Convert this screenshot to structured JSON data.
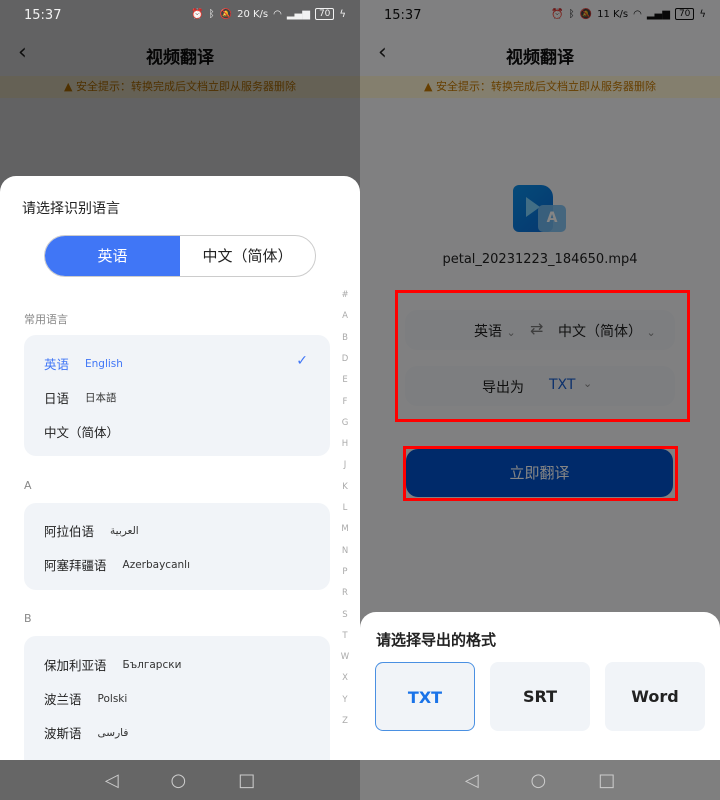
{
  "status_left": {
    "time": "15:37",
    "speed": "20 K/s",
    "battery": "70"
  },
  "status_right": {
    "time": "15:37",
    "speed": "11 K/s",
    "battery": "70"
  },
  "header": {
    "title": "视频翻译",
    "back": "‹"
  },
  "banner": {
    "icon": "warning-icon",
    "text": "安全提示：转换完成后文档立即从服务器删除"
  },
  "language_sheet": {
    "title": "请选择识别语言",
    "tabs": [
      {
        "label": "英语",
        "selected": true
      },
      {
        "label": "中文（简体）",
        "selected": false
      }
    ],
    "sections": [
      {
        "header": "常用语言",
        "items": [
          {
            "label": "英语",
            "native": "English",
            "selected": true
          },
          {
            "label": "日语",
            "native": "日本語"
          },
          {
            "label": "中文（简体）",
            "native": ""
          }
        ]
      },
      {
        "header": "A",
        "items": [
          {
            "label": "阿拉伯语",
            "native": "العربية"
          },
          {
            "label": "阿塞拜疆语",
            "native": "Azerbaycanlı"
          }
        ]
      },
      {
        "header": "B",
        "items": [
          {
            "label": "保加利亚语",
            "native": "Български"
          },
          {
            "label": "波兰语",
            "native": "Polski"
          },
          {
            "label": "波斯语",
            "native": "فارسی"
          }
        ]
      }
    ],
    "index": [
      "#",
      "A",
      "B",
      "D",
      "E",
      "F",
      "G",
      "H",
      "J",
      "K",
      "L",
      "M",
      "N",
      "P",
      "R",
      "S",
      "T",
      "W",
      "X",
      "Y",
      "Z"
    ]
  },
  "translate": {
    "filename": "petal_20231223_184650.mp4",
    "source": "英语",
    "target": "中文（简体）",
    "export_label": "导出为",
    "export_value": "TXT",
    "button": "立即翻译"
  },
  "format_sheet": {
    "title": "请选择导出的格式",
    "options": [
      {
        "label": "TXT",
        "selected": true
      },
      {
        "label": "SRT"
      },
      {
        "label": "Word"
      }
    ]
  },
  "nav": {
    "back": "◁",
    "home": "○",
    "recent": "□"
  },
  "colors": {
    "accent": "#4076f6",
    "button": "#0052cc",
    "highlight_box": "#ff0000"
  }
}
